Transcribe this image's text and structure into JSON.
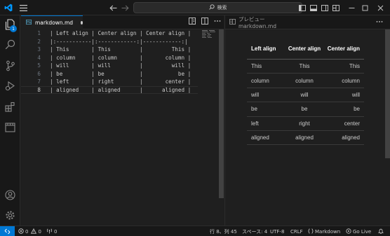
{
  "titlebar": {
    "search_label": "検索",
    "icons": [
      "vscode-logo-icon",
      "menu-icon",
      "back-arrow-icon",
      "forward-arrow-icon",
      "search-icon",
      "toggle-sidebar-icon",
      "toggle-panel-icon",
      "toggle-secondary-sidebar-icon",
      "customize-layout-icon",
      "minimize-icon",
      "maximize-icon",
      "close-icon"
    ]
  },
  "activity_bar": {
    "explorer_badge": "1",
    "icons": [
      "explorer-icon",
      "search-icon",
      "source-control-icon",
      "run-debug-icon",
      "extensions-icon",
      "remote-explorer-icon",
      "account-icon",
      "manage-gear-icon"
    ]
  },
  "editor": {
    "tab_label": "markdown.md",
    "tab_dirty": true,
    "line_numbers": [
      "1",
      "2",
      "3",
      "4",
      "5",
      "6",
      "7",
      "8"
    ],
    "current_line": 8,
    "lines": [
      "| Left align | Center align | Center align |",
      "|:-----------|:------------:|------------:|",
      "| This       | This         |         This |",
      "| column     | column       |       column |",
      "| will       | will         |         will |",
      "| be         | be           |           be |",
      "| left       | right        |       center |",
      "| aligned    | aligned      |      aligned |"
    ]
  },
  "preview": {
    "tab_label": "プレビュー markdown.md",
    "headers": [
      "Left align",
      "Center align",
      "Center align"
    ],
    "rows": [
      [
        "This",
        "This",
        "This"
      ],
      [
        "column",
        "column",
        "column"
      ],
      [
        "will",
        "will",
        "will"
      ],
      [
        "be",
        "be",
        "be"
      ],
      [
        "left",
        "right",
        "center"
      ],
      [
        "aligned",
        "aligned",
        "aligned"
      ]
    ]
  },
  "statusbar": {
    "errors": "0",
    "warnings": "0",
    "ports": "0",
    "position": "行 8、列 45",
    "spaces": "スペース: 4",
    "encoding": "UTF-8",
    "eol": "CRLF",
    "language": "Markdown",
    "live": "Go Live"
  },
  "colors": {
    "accent": "#0078d4",
    "background": "#1f1f1f",
    "chrome": "#181818"
  }
}
